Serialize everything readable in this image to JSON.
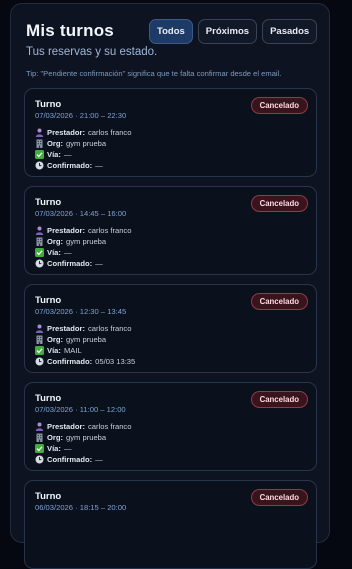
{
  "header": {
    "title": "Mis turnos",
    "subtitle": "Tus reservas y su estado.",
    "tip": "Tip: \"Pendiente confirmación\" significa que te falta confirmar desde el email."
  },
  "filters": [
    {
      "label": "Todos",
      "active": true
    },
    {
      "label": "Próximos",
      "active": false
    },
    {
      "label": "Pasados",
      "active": false
    }
  ],
  "labels": {
    "prestador": "Prestador:",
    "org": "Org:",
    "via": "Vía:",
    "confirmado": "Confirmado:"
  },
  "colors": {
    "accent": "#1e3a66",
    "cancel_badge": "#9c3545"
  },
  "bookings": [
    {
      "title": "Turno",
      "datetime": "07/03/2026 · 21:00 – 22:30",
      "status": "Cancelado",
      "prestador": "carlos franco",
      "org": "gym prueba",
      "via": "—",
      "confirmado": "—"
    },
    {
      "title": "Turno",
      "datetime": "07/03/2026 · 14:45 – 16:00",
      "status": "Cancelado",
      "prestador": "carlos franco",
      "org": "gym prueba",
      "via": "—",
      "confirmado": "—"
    },
    {
      "title": "Turno",
      "datetime": "07/03/2026 · 12:30 – 13:45",
      "status": "Cancelado",
      "prestador": "carlos franco",
      "org": "gym prueba",
      "via": "MAIL",
      "confirmado": "05/03 13:35"
    },
    {
      "title": "Turno",
      "datetime": "07/03/2026 · 11:00 – 12:00",
      "status": "Cancelado",
      "prestador": "carlos franco",
      "org": "gym prueba",
      "via": "—",
      "confirmado": "—"
    },
    {
      "title": "Turno",
      "datetime": "06/03/2026 · 18:15 – 20:00",
      "status": "Cancelado"
    }
  ]
}
